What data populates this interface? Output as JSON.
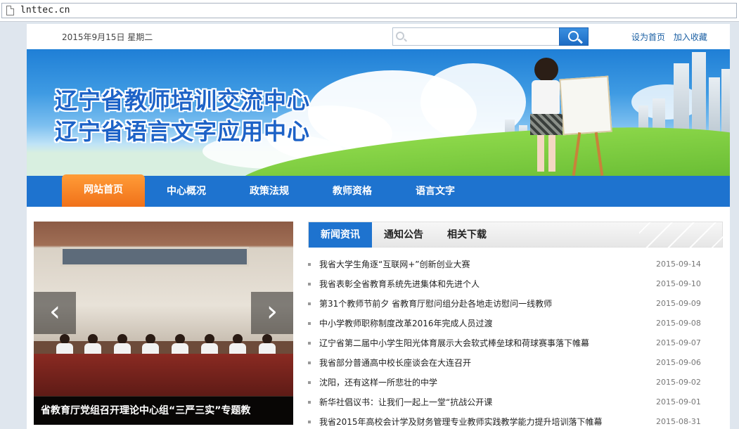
{
  "browser": {
    "url": "lnttec.cn"
  },
  "topbar": {
    "date": "2015年9月15日  星期二",
    "search_placeholder": "",
    "link_home": "设为首页",
    "link_favorite": "加入收藏"
  },
  "banner": {
    "title_line1": "辽宁省教师培训交流中心",
    "title_line2": "辽宁省语言文字应用中心"
  },
  "nav": {
    "items": [
      {
        "label": "网站首页"
      },
      {
        "label": "中心概况"
      },
      {
        "label": "政策法规"
      },
      {
        "label": "教师资格"
      },
      {
        "label": "语言文字"
      }
    ]
  },
  "slideshow": {
    "caption": "省教育厅党组召开理论中心组“三严三实”专题教"
  },
  "tabs": [
    {
      "label": "新闻资讯"
    },
    {
      "label": "通知公告"
    },
    {
      "label": "相关下载"
    }
  ],
  "news": [
    {
      "title": "我省大学生角逐“互联网+”创新创业大赛",
      "date": "2015-09-14"
    },
    {
      "title": "我省表彰全省教育系统先进集体和先进个人",
      "date": "2015-09-10"
    },
    {
      "title": "第31个教师节前夕  省教育厅慰问组分赴各地走访慰问一线教师",
      "date": "2015-09-09"
    },
    {
      "title": "中小学教师职称制度改革2016年完成人员过渡",
      "date": "2015-09-08"
    },
    {
      "title": "辽宁省第二届中小学生阳光体育展示大会软式棒垒球和荷球赛事落下帷幕",
      "date": "2015-09-07"
    },
    {
      "title": "我省部分普通高中校长座谈会在大连召开",
      "date": "2015-09-06"
    },
    {
      "title": "沈阳，还有这样一所悲壮的中学",
      "date": "2015-09-02"
    },
    {
      "title": "新华社倡议书：让我们一起上一堂“抗战公开课",
      "date": "2015-09-01"
    },
    {
      "title": "我省2015年高校会计学及财务管理专业教师实践教学能力提升培训落下帷幕",
      "date": "2015-08-31"
    }
  ]
}
